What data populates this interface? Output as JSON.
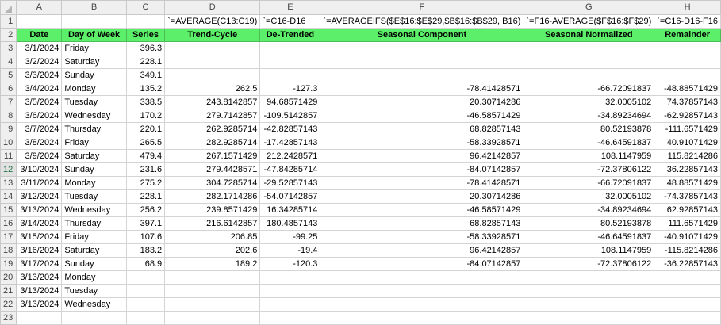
{
  "columns": [
    "A",
    "B",
    "C",
    "D",
    "E",
    "F",
    "G",
    "H"
  ],
  "formulas": {
    "D": "`=AVERAGE(C13:C19)",
    "E": "`=C16-D16",
    "F": "`=AVERAGEIFS($E$16:$E$29,$B$16:$B$29, B16)",
    "G": "`=F16-AVERAGE($F$16:$F$29)",
    "H": "`=C16-D16-F16"
  },
  "headers": [
    "Date",
    "Day of Week",
    "Series",
    "Trend-Cycle",
    "De-Trended",
    "Seasonal Component",
    "Seasonal Normalized",
    "Remainder"
  ],
  "rows": [
    [
      "3/1/2024",
      "Friday",
      "396.3",
      "",
      "",
      "",
      "",
      ""
    ],
    [
      "3/2/2024",
      "Saturday",
      "228.1",
      "",
      "",
      "",
      "",
      ""
    ],
    [
      "3/3/2024",
      "Sunday",
      "349.1",
      "",
      "",
      "",
      "",
      ""
    ],
    [
      "3/4/2024",
      "Monday",
      "135.2",
      "262.5",
      "-127.3",
      "-78.41428571",
      "-66.72091837",
      "-48.88571429"
    ],
    [
      "3/5/2024",
      "Tuesday",
      "338.5",
      "243.8142857",
      "94.68571429",
      "20.30714286",
      "32.0005102",
      "74.37857143"
    ],
    [
      "3/6/2024",
      "Wednesday",
      "170.2",
      "279.7142857",
      "-109.5142857",
      "-46.58571429",
      "-34.89234694",
      "-62.92857143"
    ],
    [
      "3/7/2024",
      "Thursday",
      "220.1",
      "262.9285714",
      "-42.82857143",
      "68.82857143",
      "80.52193878",
      "-111.6571429"
    ],
    [
      "3/8/2024",
      "Friday",
      "265.5",
      "282.9285714",
      "-17.42857143",
      "-58.33928571",
      "-46.64591837",
      "40.91071429"
    ],
    [
      "3/9/2024",
      "Saturday",
      "479.4",
      "267.1571429",
      "212.2428571",
      "96.42142857",
      "108.1147959",
      "115.8214286"
    ],
    [
      "3/10/2024",
      "Sunday",
      "231.6",
      "279.4428571",
      "-47.84285714",
      "-84.07142857",
      "-72.37806122",
      "36.22857143"
    ],
    [
      "3/11/2024",
      "Monday",
      "275.2",
      "304.7285714",
      "-29.52857143",
      "-78.41428571",
      "-66.72091837",
      "48.88571429"
    ],
    [
      "3/12/2024",
      "Tuesday",
      "228.1",
      "282.1714286",
      "-54.07142857",
      "20.30714286",
      "32.0005102",
      "-74.37857143"
    ],
    [
      "3/13/2024",
      "Wednesday",
      "256.2",
      "239.8571429",
      "16.34285714",
      "-46.58571429",
      "-34.89234694",
      "62.92857143"
    ],
    [
      "3/14/2024",
      "Thursday",
      "397.1",
      "216.6142857",
      "180.4857143",
      "68.82857143",
      "80.52193878",
      "111.6571429"
    ],
    [
      "3/15/2024",
      "Friday",
      "107.6",
      "206.85",
      "-99.25",
      "-58.33928571",
      "-46.64591837",
      "-40.91071429"
    ],
    [
      "3/16/2024",
      "Saturday",
      "183.2",
      "202.6",
      "-19.4",
      "96.42142857",
      "108.1147959",
      "-115.8214286"
    ],
    [
      "3/17/2024",
      "Sunday",
      "68.9",
      "189.2",
      "-120.3",
      "-84.07142857",
      "-72.37806122",
      "-36.22857143"
    ],
    [
      "3/13/2024",
      "Monday",
      "",
      "",
      "",
      "",
      "",
      ""
    ],
    [
      "3/13/2024",
      "Tuesday",
      "",
      "",
      "",
      "",
      "",
      ""
    ],
    [
      "3/13/2024",
      "Wednesday",
      "",
      "",
      "",
      "",
      "",
      ""
    ],
    [
      "",
      "",
      "",
      "",
      "",
      "",
      "",
      ""
    ]
  ]
}
